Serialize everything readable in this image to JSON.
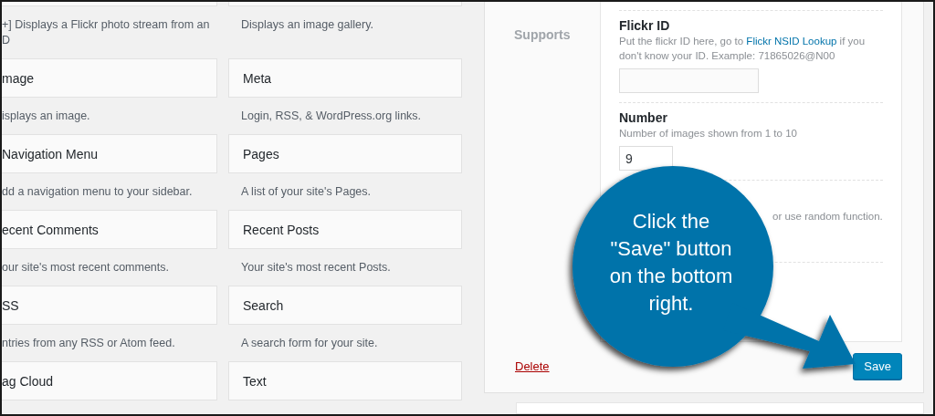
{
  "widgets": [
    {
      "description": "+] Displays a Flickr photo stream from an\nD"
    },
    {
      "description": "Displays an image gallery."
    },
    {
      "title": "mage",
      "description": "isplays an image."
    },
    {
      "title": "Meta",
      "description": "Login, RSS, & WordPress.org links."
    },
    {
      "title": "Navigation Menu",
      "description": "dd a navigation menu to your sidebar."
    },
    {
      "title": "Pages",
      "description": "A list of your site's Pages."
    },
    {
      "title": "ecent Comments",
      "description": "our site's most recent comments."
    },
    {
      "title": "Recent Posts",
      "description": "Your site's most recent Posts."
    },
    {
      "title": "SS",
      "description": "ntries from any RSS or Atom feed."
    },
    {
      "title": "Search",
      "description": "A search form for your site."
    },
    {
      "title": "ag Cloud"
    },
    {
      "title": "Text"
    }
  ],
  "settings_nav": [
    "Supports"
  ],
  "fields": [
    {
      "kind": "text",
      "label": "Flickr ID",
      "help": "Put the flickr ID here, go to",
      "link": "Flickr NSID Lookup",
      "help_after": "if you don't know your ID. Example: 71865026@N00"
    },
    {
      "kind": "number",
      "label": "Number",
      "help": "Number of images shown from 1 to 10",
      "value": "9"
    },
    {
      "kind": "covered",
      "help": "or use random function."
    }
  ],
  "delete_link": "Delete",
  "save_button": "Save",
  "callout": {
    "lines": [
      "Click the",
      "\"Save\" button",
      "on the bottom",
      "right."
    ]
  }
}
